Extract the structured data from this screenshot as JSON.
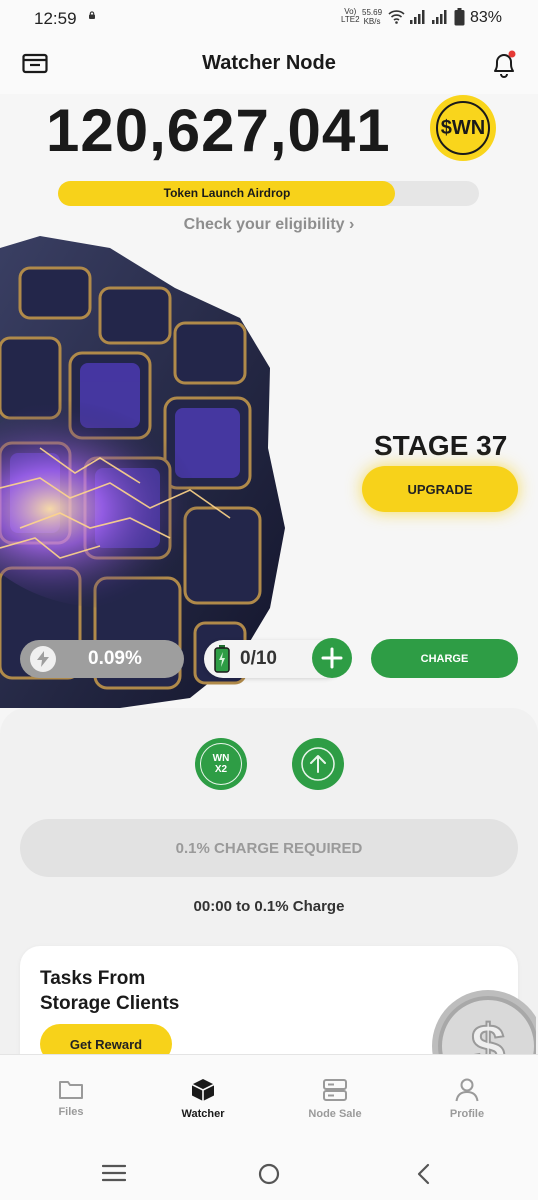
{
  "status_bar": {
    "time": "12:59",
    "network_line1": "Vo)",
    "network_line2": "LTE2",
    "speed_value": "55.69",
    "speed_unit": "KB/s",
    "battery": "83%"
  },
  "header": {
    "title": "Watcher Node",
    "left_icon": "wallet-icon",
    "right_icon": "bell-icon",
    "notification_dot_color": "#e53935"
  },
  "balance": {
    "amount": "120,627,041",
    "token_badge": "$WN"
  },
  "airdrop": {
    "label": "Token Launch Airdrop",
    "progress": 0.8,
    "eligibility_link": "Check your eligibility ›"
  },
  "stage": {
    "label": "STAGE 37",
    "upgrade_label": "UPGRADE"
  },
  "controls": {
    "energy_value": "0.09%",
    "battery_count": "0/10",
    "charge_label": "CHARGE"
  },
  "boosts": {
    "multiplier_line1": "WN",
    "multiplier_line2": "X2"
  },
  "charge_required": {
    "button_label": "0.1% CHARGE REQUIRED",
    "timer_text": "00:00 to 0.1% Charge"
  },
  "tasks": {
    "title_line1": "Tasks From",
    "title_line2": "Storage Clients",
    "reward_label": "Get Reward"
  },
  "nav": {
    "items": [
      {
        "label": "Files",
        "icon": "folder-icon"
      },
      {
        "label": "Watcher",
        "icon": "cube-icon"
      },
      {
        "label": "Node Sale",
        "icon": "server-icon"
      },
      {
        "label": "Profile",
        "icon": "person-icon"
      }
    ],
    "active_index": 1
  },
  "colors": {
    "accent_yellow": "#f7d21a",
    "accent_green": "#2e9d45",
    "background": "#f6f6f6"
  }
}
